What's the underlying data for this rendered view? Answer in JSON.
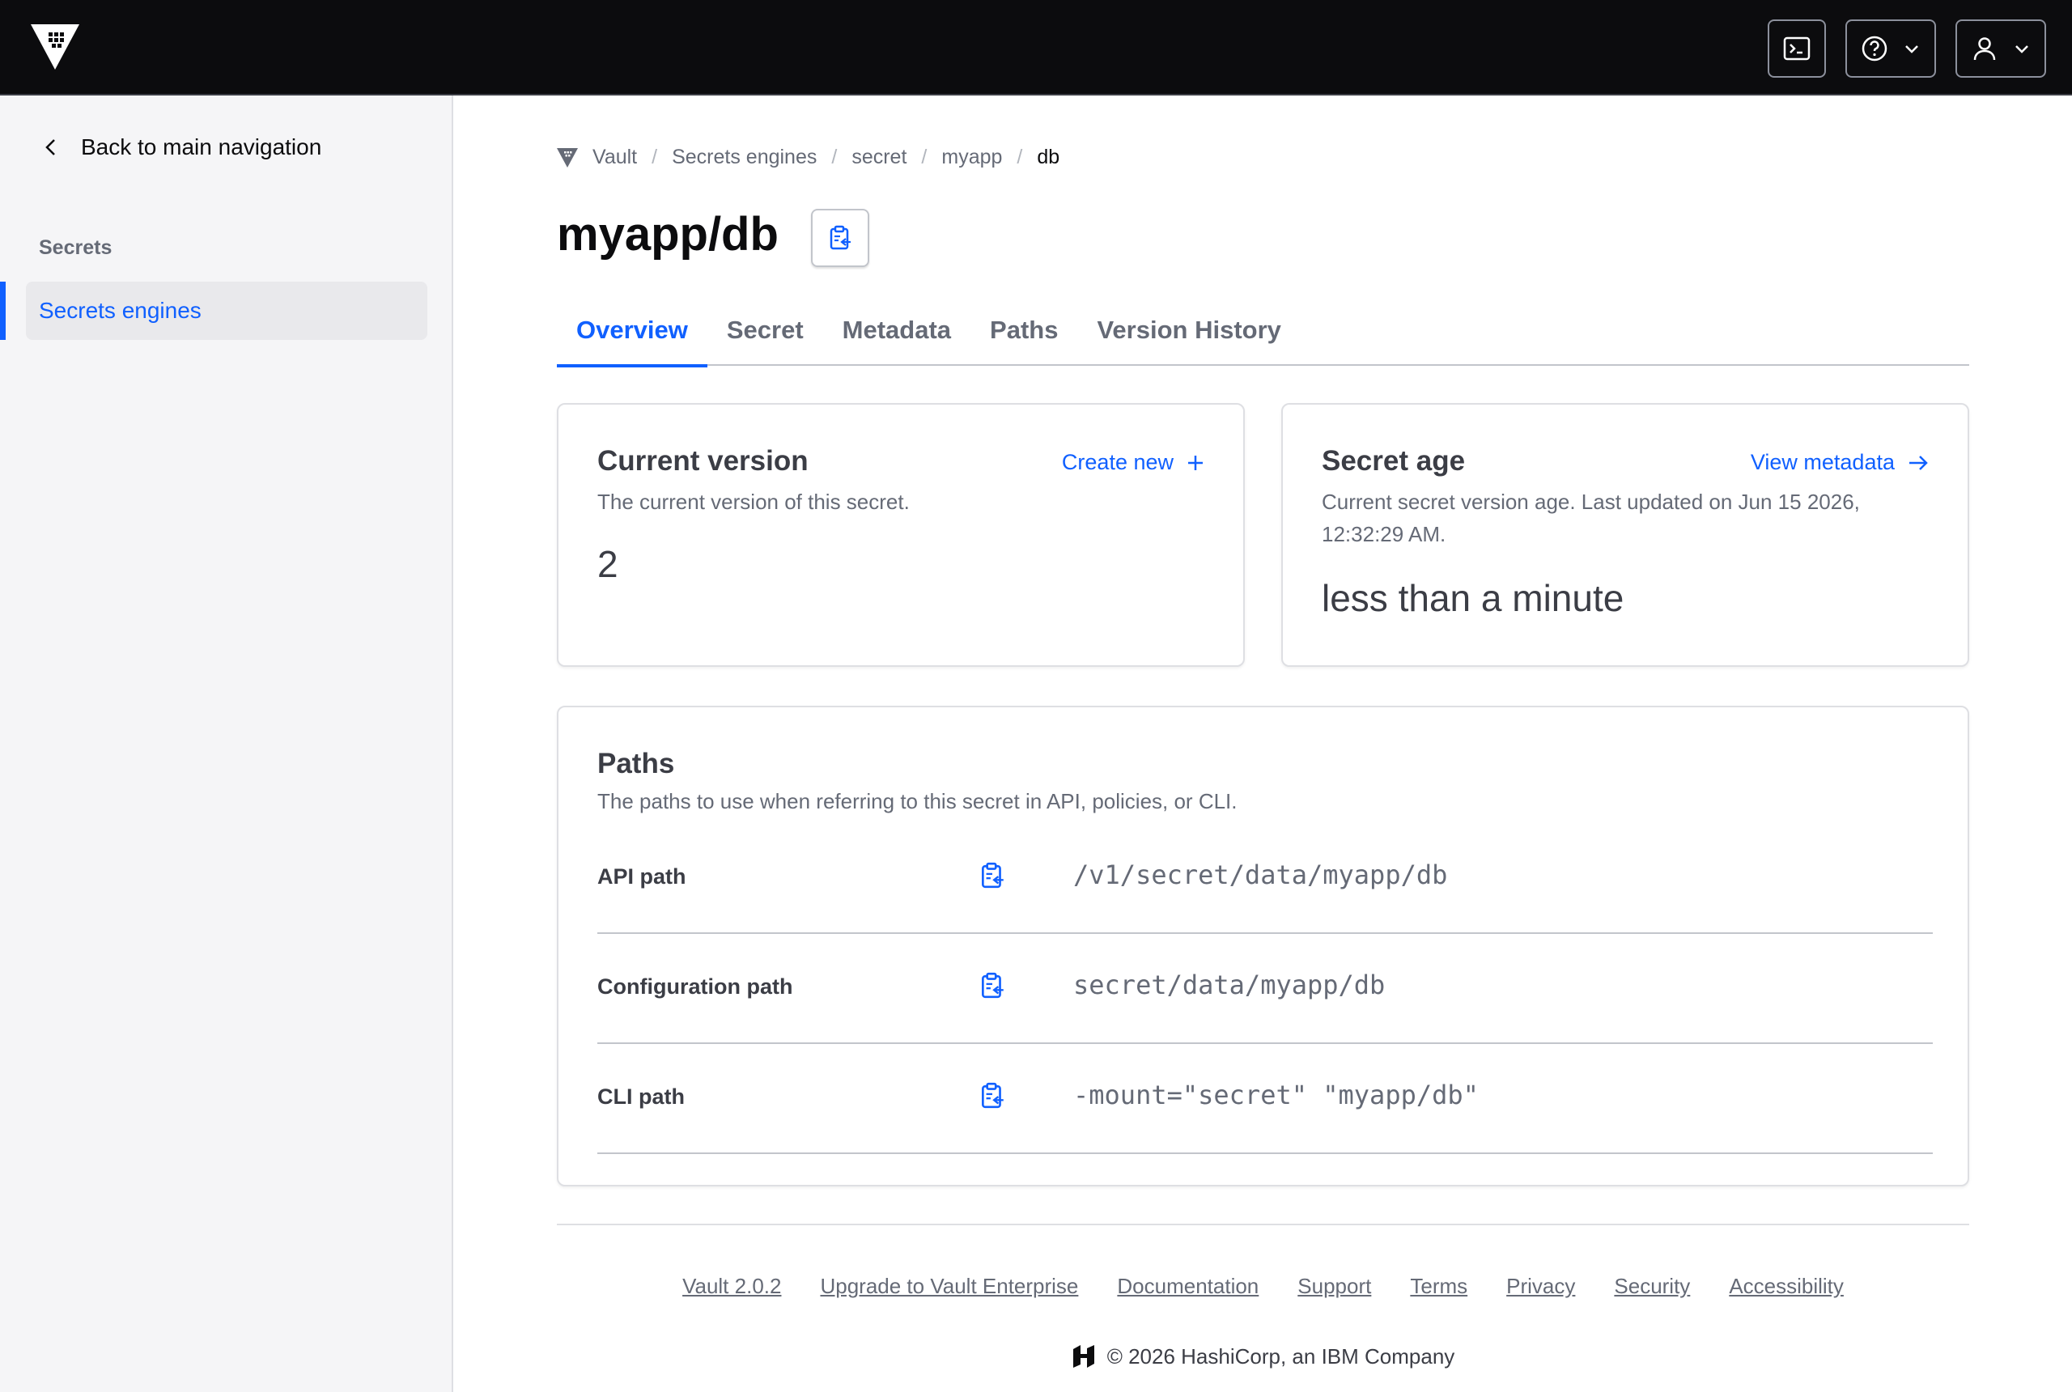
{
  "sidebar": {
    "back_label": "Back to main navigation",
    "section_heading": "Secrets",
    "items": [
      {
        "label": "Secrets engines",
        "active": true
      }
    ]
  },
  "breadcrumb": {
    "items": [
      "Vault",
      "Secrets engines",
      "secret",
      "myapp"
    ],
    "current": "db"
  },
  "page": {
    "title": "myapp/db"
  },
  "tabs": [
    {
      "label": "Overview",
      "active": true
    },
    {
      "label": "Secret"
    },
    {
      "label": "Metadata"
    },
    {
      "label": "Paths"
    },
    {
      "label": "Version History"
    }
  ],
  "current_version": {
    "title": "Current version",
    "description": "The current version of this secret.",
    "action": "Create new",
    "value": "2"
  },
  "secret_age": {
    "title": "Secret age",
    "description": "Current secret version age. Last updated on Jun 15 2026, 12:32:29 AM.",
    "action": "View metadata",
    "value": "less than a minute"
  },
  "paths": {
    "title": "Paths",
    "description": "The paths to use when referring to this secret in API, policies, or CLI.",
    "rows": [
      {
        "label": "API path",
        "value": "/v1/secret/data/myapp/db"
      },
      {
        "label": "Configuration path",
        "value": "secret/data/myapp/db"
      },
      {
        "label": "CLI path",
        "value": "-mount=\"secret\" \"myapp/db\""
      }
    ]
  },
  "footer": {
    "links": [
      "Vault 2.0.2",
      "Upgrade to Vault Enterprise",
      "Documentation",
      "Support",
      "Terms",
      "Privacy",
      "Security",
      "Accessibility"
    ],
    "copyright": "© 2026 HashiCorp, an IBM Company"
  },
  "colors": {
    "accent": "#1060ff",
    "topbar": "#0c0c0e"
  }
}
